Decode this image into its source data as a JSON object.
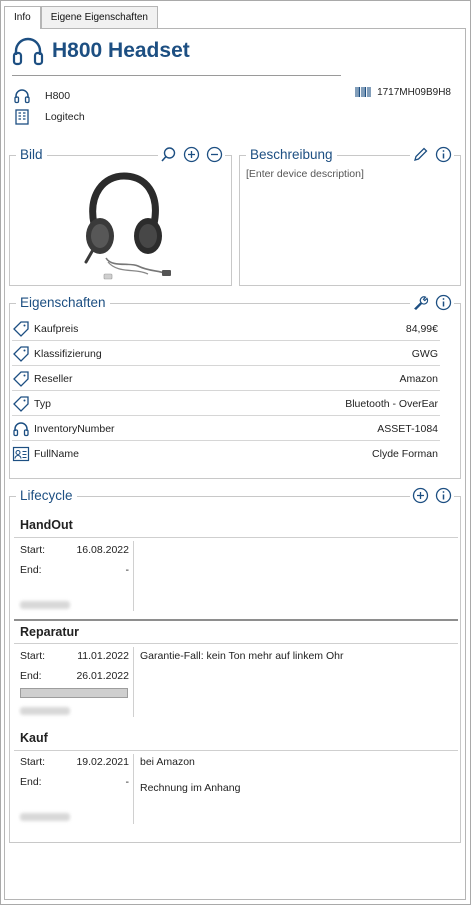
{
  "tabs": [
    {
      "label": "Info",
      "active": true
    },
    {
      "label": "Eigene Eigenschaften",
      "active": false
    }
  ],
  "device": {
    "title": "H800 Headset",
    "model": "H800",
    "manufacturer": "Logitech",
    "serial": "1717MH09B9H8"
  },
  "bild": {
    "title": "Bild",
    "icons": [
      "search-icon",
      "zoom-in-icon",
      "zoom-out-icon"
    ]
  },
  "beschreibung": {
    "title": "Beschreibung",
    "placeholder": "[Enter device description]",
    "icons": [
      "pencil-icon",
      "info-icon"
    ]
  },
  "eigenschaften": {
    "title": "Eigenschaften",
    "icons": [
      "wrench-icon",
      "info-icon"
    ],
    "rows": [
      {
        "icon": "tag-icon",
        "name": "Kaufpreis",
        "value": "84,99€"
      },
      {
        "icon": "tag-icon",
        "name": "Klassifizierung",
        "value": "GWG"
      },
      {
        "icon": "tag-icon",
        "name": "Reseller",
        "value": "Amazon"
      },
      {
        "icon": "tag-icon",
        "name": "Typ",
        "value": "Bluetooth - OverEar"
      },
      {
        "icon": "headset-icon",
        "name": "InventoryNumber",
        "value": "ASSET-1084"
      },
      {
        "icon": "contact-card-icon",
        "name": "FullName",
        "value": "Clyde Forman"
      }
    ]
  },
  "lifecycle": {
    "title": "Lifecycle",
    "icons": [
      "add-icon",
      "info-icon"
    ],
    "start_label": "Start:",
    "end_label": "End:",
    "sections": [
      {
        "name": "HandOut",
        "start": "16.08.2022",
        "end": "-",
        "descriptions": []
      },
      {
        "name": "Reparatur",
        "start": "11.01.2022",
        "end": "26.01.2022",
        "progress": 1.0,
        "descriptions": [
          "Garantie-Fall: kein Ton mehr auf linkem Ohr"
        ]
      },
      {
        "name": "Kauf",
        "start": "19.02.2021",
        "end": "-",
        "descriptions": [
          "bei Amazon",
          "Rechnung im Anhang"
        ]
      }
    ]
  },
  "colors": {
    "accent": "#1d4f82",
    "border": "#c8c8c8"
  }
}
